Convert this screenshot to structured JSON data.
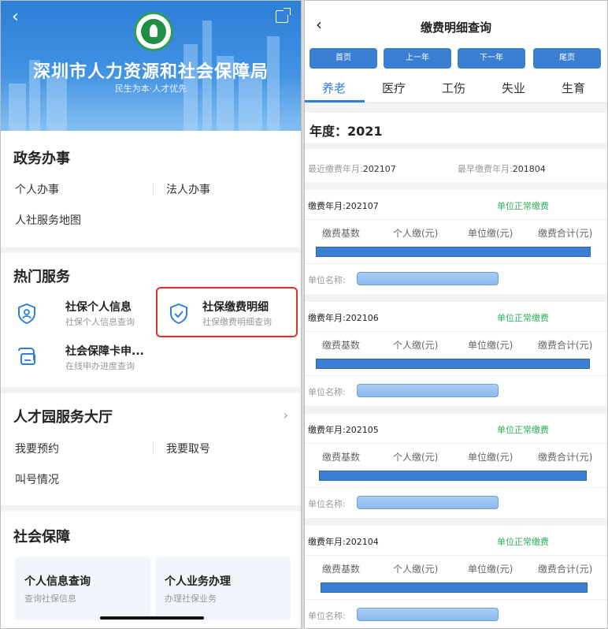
{
  "left": {
    "org_title": "深圳市人力资源和社会保障局",
    "org_subtitle": "民生为本·人才优先",
    "gov_affairs": {
      "title": "政务办事",
      "items": [
        "个人办事",
        "法人办事",
        "人社服务地图"
      ]
    },
    "hot_services": {
      "title": "热门服务",
      "items": [
        {
          "title": "社保个人信息",
          "subtitle": "社保个人信息查询",
          "icon": "shield-person-icon"
        },
        {
          "title": "社保缴费明细",
          "subtitle": "社保缴费明细查询",
          "icon": "shield-check-icon"
        },
        {
          "title": "社会保障卡申...",
          "subtitle": "在线申办进度查询",
          "icon": "card-icon"
        }
      ]
    },
    "talent_hall": {
      "title": "人才园服务大厅",
      "chevron": "›",
      "items": [
        "我要预约",
        "我要取号",
        "叫号情况"
      ]
    },
    "social_security": {
      "title": "社会保障",
      "tiles": [
        {
          "title": "个人信息查询",
          "subtitle": "查询社保信息"
        },
        {
          "title": "个人业务办理",
          "subtitle": "办理社保业务"
        }
      ]
    },
    "colors": {
      "accent": "#2f7fd6",
      "highlight": "#e0302a"
    }
  },
  "right": {
    "title": "缴费明细查询",
    "nav_buttons": [
      "首页",
      "上一年",
      "下一年",
      "尾页"
    ],
    "tabs": [
      "养老",
      "医疗",
      "工伤",
      "失业",
      "生育"
    ],
    "active_tab": "养老",
    "year_label": "年度：2021",
    "recent_label": "最近缴费年月:",
    "recent_value": "202107",
    "earliest_label": "最早缴费年月:",
    "earliest_value": "201804",
    "column_headers": [
      "缴费基数",
      "个人缴(元)",
      "单位缴(元)",
      "缴费合计(元)"
    ],
    "unit_label": "单位名称:",
    "records": [
      {
        "month": "缴费年月:202107",
        "status": "单位正常缴费"
      },
      {
        "month": "缴费年月:202106",
        "status": "单位正常缴费"
      },
      {
        "month": "缴费年月:202105",
        "status": "单位正常缴费"
      },
      {
        "month": "缴费年月:202104",
        "status": "单位正常缴费"
      }
    ],
    "colors": {
      "accent": "#2f7fd6",
      "status": "#2db05a",
      "button": "#3a7fd1"
    }
  }
}
